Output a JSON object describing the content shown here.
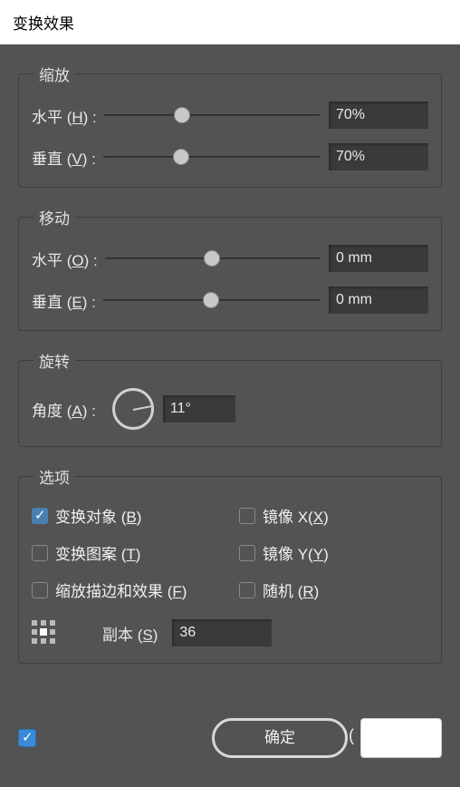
{
  "window": {
    "title": "变换效果"
  },
  "scale": {
    "legend": "缩放",
    "h_label_pre": "水平 (",
    "h_accel": "H",
    "h_label_post": ") :",
    "h_value": "70%",
    "h_thumb_pct": 36,
    "v_label_pre": "垂直 (",
    "v_accel": "V",
    "v_label_post": ") :",
    "v_value": "70%",
    "v_thumb_pct": 36
  },
  "move": {
    "legend": "移动",
    "h_label_pre": "水平 (",
    "h_accel": "O",
    "h_label_post": ") :",
    "h_value": "0 mm",
    "h_thumb_pct": 50,
    "v_label_pre": "垂直 (",
    "v_accel": "E",
    "v_label_post": ") :",
    "v_value": "0 mm",
    "v_thumb_pct": 50
  },
  "rotate": {
    "legend": "旋转",
    "label_pre": "角度 (",
    "accel": "A",
    "label_post": ") :",
    "value": "11°"
  },
  "options": {
    "legend": "选项",
    "transform_object": {
      "label_pre": "变换对象 (",
      "accel": "B",
      "label_post": ")",
      "checked": true
    },
    "transform_pattern": {
      "label_pre": "变换图案 (",
      "accel": "T",
      "label_post": ")",
      "checked": false
    },
    "scale_strokes": {
      "label_pre": "缩放描边和效果 (",
      "accel": "F",
      "label_post": ")",
      "checked": false
    },
    "reflect_x": {
      "label_pre": "镜像 X(",
      "accel": "X",
      "label_post": ")",
      "checked": false
    },
    "reflect_y": {
      "label_pre": "镜像 Y(",
      "accel": "Y",
      "label_post": ")",
      "checked": false
    },
    "random": {
      "label_pre": "随机 (",
      "accel": "R",
      "label_post": ")",
      "checked": false
    },
    "copies_label_pre": "副本 (",
    "copies_accel": "S",
    "copies_label_post": ")",
    "copies_value": "36"
  },
  "buttons": {
    "ok": "确定"
  }
}
